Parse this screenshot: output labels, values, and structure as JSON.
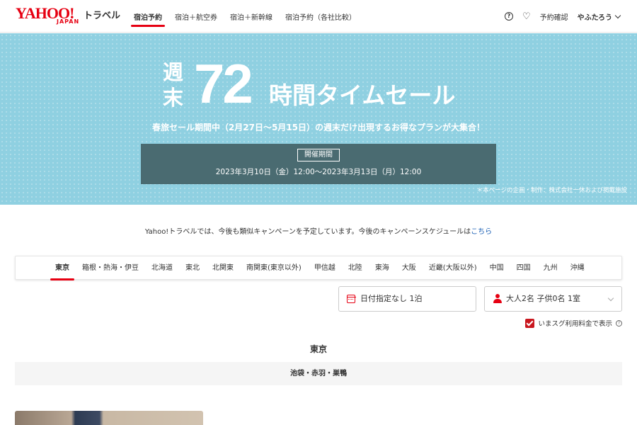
{
  "header": {
    "logo_main": "YAHOO!",
    "logo_sub": "JAPAN",
    "logo_service": "トラベル",
    "nav": [
      {
        "label": "宿泊予約",
        "active": true
      },
      {
        "label": "宿泊＋航空券",
        "active": false
      },
      {
        "label": "宿泊＋新幹線",
        "active": false
      },
      {
        "label": "宿泊予約（各社比較）",
        "active": false
      }
    ],
    "help_icon": "?",
    "favorites_icon": "♡",
    "reservation_link": "予約確認",
    "user_name": "やふたろう"
  },
  "banner": {
    "title_prefix_1": "週",
    "title_prefix_2": "末",
    "title_number": "72",
    "title_text": "時間タイムセール",
    "subtitle": "春旅セール期間中（2月27日～5月15日）の週末だけ出現するお得なプランが大集合！",
    "period_label": "開催期間",
    "period_dates": "2023年3月10日（金）12:00～2023年3月13日（月）12:00",
    "note": "＊本ページの企画・制作：株式会社一休および掲載施設",
    "background_color": "#8fd0e1"
  },
  "info": {
    "text": "Yahoo!トラベルでは、今後も類似キャンペーンを予定しています。今後のキャンペーンスケジュールは",
    "link": "こちら"
  },
  "regions": [
    {
      "label": "東京",
      "active": true
    },
    {
      "label": "箱根・熱海・伊豆",
      "active": false
    },
    {
      "label": "北海道",
      "active": false
    },
    {
      "label": "東北",
      "active": false
    },
    {
      "label": "北関東",
      "active": false
    },
    {
      "label": "南関東(東京以外)",
      "active": false
    },
    {
      "label": "甲信越",
      "active": false
    },
    {
      "label": "北陸",
      "active": false
    },
    {
      "label": "東海",
      "active": false
    },
    {
      "label": "大阪",
      "active": false
    },
    {
      "label": "近畿(大阪以外)",
      "active": false
    },
    {
      "label": "中国",
      "active": false
    },
    {
      "label": "四国",
      "active": false
    },
    {
      "label": "九州",
      "active": false
    },
    {
      "label": "沖縄",
      "active": false
    }
  ],
  "search": {
    "date_text": "日付指定なし 1泊",
    "guest_text": "大人2名 子供0名 1室",
    "price_toggle_label": "いまスグ利用料金で表示",
    "price_toggle_checked": true,
    "help_icon": "?"
  },
  "area": {
    "title": "東京",
    "sub_area": "池袋・赤羽・巣鴨"
  },
  "colors": {
    "accent": "#e60012",
    "period_box": "#4a6b71",
    "checkbox": "#c9171e",
    "link": "#1a5fb4"
  }
}
